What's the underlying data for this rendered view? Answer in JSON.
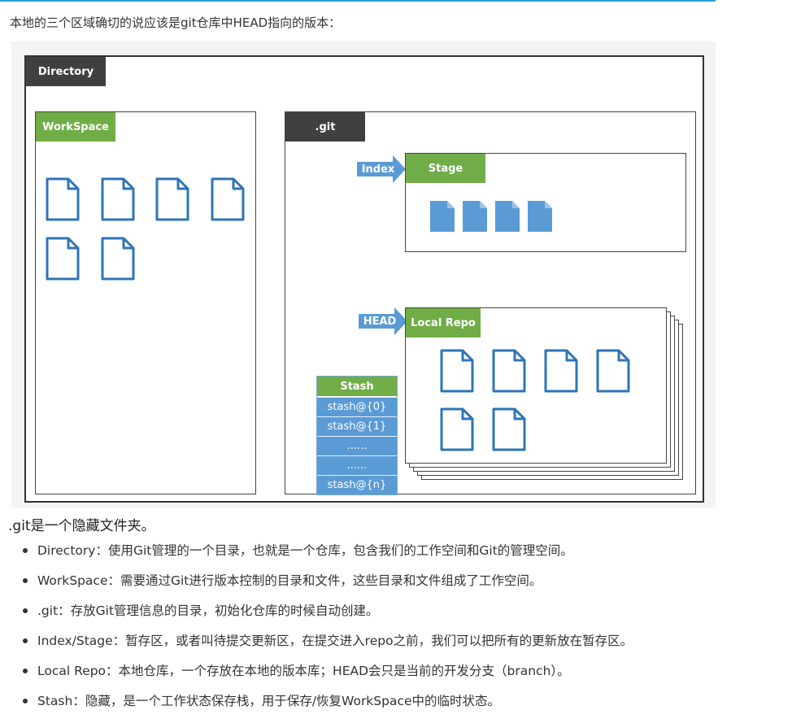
{
  "intro": "本地的三个区域确切的说应该是git仓库中HEAD指向的版本：",
  "diagram": {
    "directory_label": "Directory",
    "workspace_label": "WorkSpace",
    "git_label": ".git",
    "index_label": "Index",
    "stage_label": "Stage",
    "head_label": "HEAD",
    "local_repo_label": "Local Repo",
    "stash": {
      "title": "Stash",
      "rows": [
        "stash@{0}",
        "stash@{1}",
        "......",
        "......",
        "stash@{n}"
      ]
    },
    "colors": {
      "green": "#70ad47",
      "blue": "#5b9bd5",
      "dark": "#404040",
      "file_outline": "#2e75b6"
    },
    "icons": [
      "file-outline-icon",
      "file-filled-icon",
      "arrow-right-icon"
    ]
  },
  "heading": ".git是一个隐藏文件夹。",
  "items": [
    "Directory：使用Git管理的一个目录，也就是一个仓库，包含我们的工作空间和Git的管理空间。",
    "WorkSpace：需要通过Git进行版本控制的目录和文件，这些目录和文件组成了工作空间。",
    ".git：存放Git管理信息的目录，初始化仓库的时候自动创建。",
    "Index/Stage：暂存区，或者叫待提交更新区，在提交进入repo之前，我们可以把所有的更新放在暂存区。",
    "Local Repo：本地仓库，一个存放在本地的版本库；HEAD会只是当前的开发分支（branch）。",
    "Stash：隐藏，是一个工作状态保存栈，用于保存/恢复WorkSpace中的临时状态。"
  ]
}
